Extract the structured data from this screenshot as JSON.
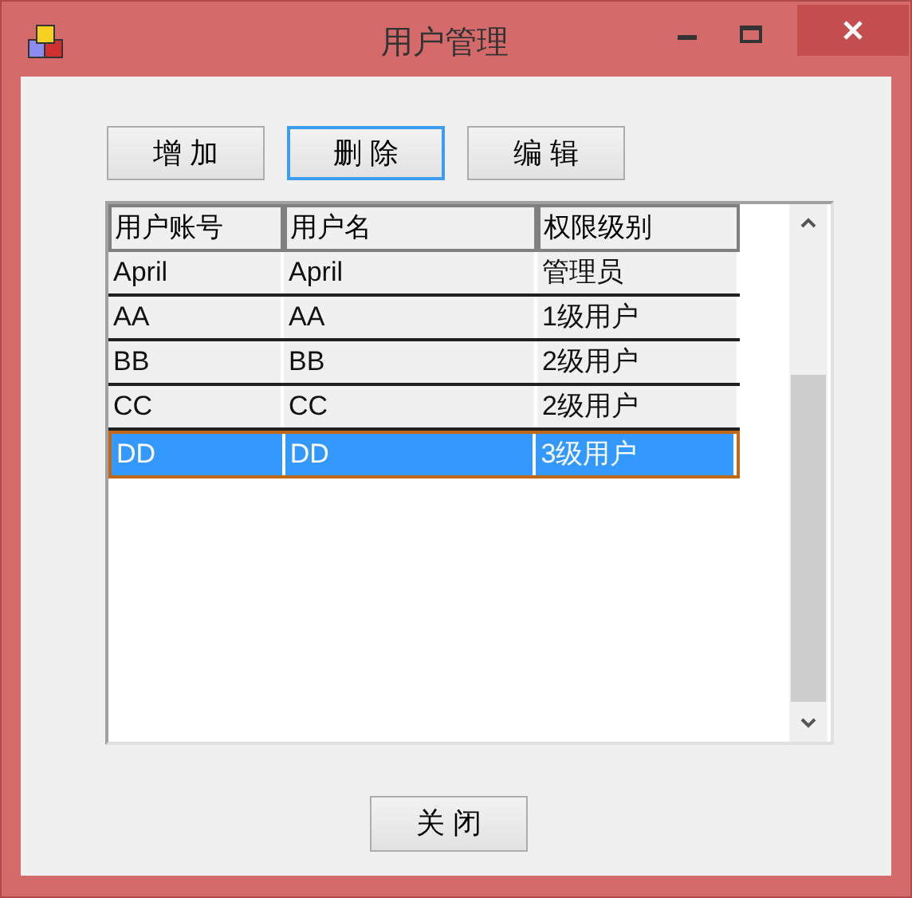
{
  "window": {
    "title": "用户管理"
  },
  "toolbar": [
    {
      "label": "增 加",
      "focused": false
    },
    {
      "label": "删 除",
      "focused": true
    },
    {
      "label": "编 辑",
      "focused": false
    }
  ],
  "table": {
    "columns": [
      "用户账号",
      "用户名",
      "权限级别"
    ],
    "rows": [
      {
        "cells": [
          "April",
          "April",
          "管理员"
        ],
        "selected": false
      },
      {
        "cells": [
          "AA",
          "AA",
          "1级用户"
        ],
        "selected": false
      },
      {
        "cells": [
          "BB",
          "BB",
          "2级用户"
        ],
        "selected": false
      },
      {
        "cells": [
          "CC",
          "CC",
          "2级用户"
        ],
        "selected": false
      },
      {
        "cells": [
          "DD",
          "DD",
          "3级用户"
        ],
        "selected": true
      }
    ]
  },
  "close_button": {
    "label": "关 闭"
  }
}
